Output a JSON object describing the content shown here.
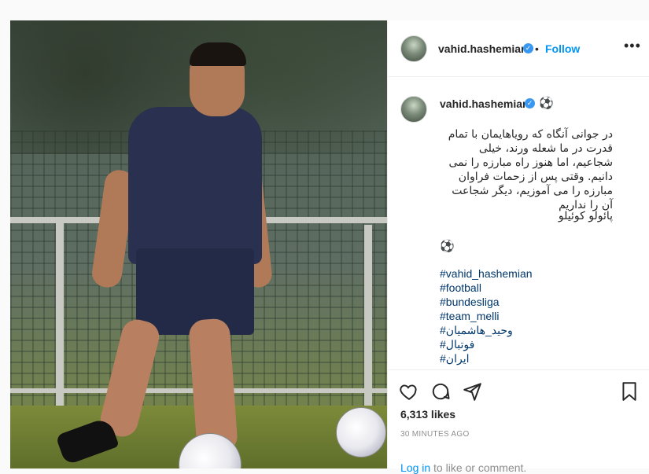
{
  "post": {
    "username": "vahid.hashemian",
    "follow_label": "Follow",
    "more_label": "•••",
    "separator": "•"
  },
  "caption": {
    "username": "vahid.hashemian",
    "emoji": "⚽",
    "text": "در جوانی آنگاه که رویاهایمان با تمام قدرت در ما شعله ورند، خیلی شجاعیم، اما هنوز راه مبارزه را نمی دانیم. وقتی پس از زحمات فراوان مبارزه را می آموزیم، دیگر شجاعت آن را نداریم",
    "author": "پائولو کوئیلو",
    "emoji_line": "⚽",
    "hashtags": [
      "#vahid_hashemian",
      "#football",
      "#bundesliga",
      "#team_melli",
      "#وحید_هاشمیان",
      "#فوتبال",
      "#ایران"
    ]
  },
  "actions": {
    "likes": "6,313 likes",
    "time": "30 MINUTES AGO",
    "login_link": "Log in",
    "login_rest": " to like or comment."
  },
  "colors": {
    "link": "#00376b",
    "accent": "#0095f6",
    "verified": "#3897f0"
  },
  "icons": [
    "heart-icon",
    "comment-icon",
    "share-icon",
    "bookmark-icon",
    "verified-icon",
    "more-icon"
  ]
}
